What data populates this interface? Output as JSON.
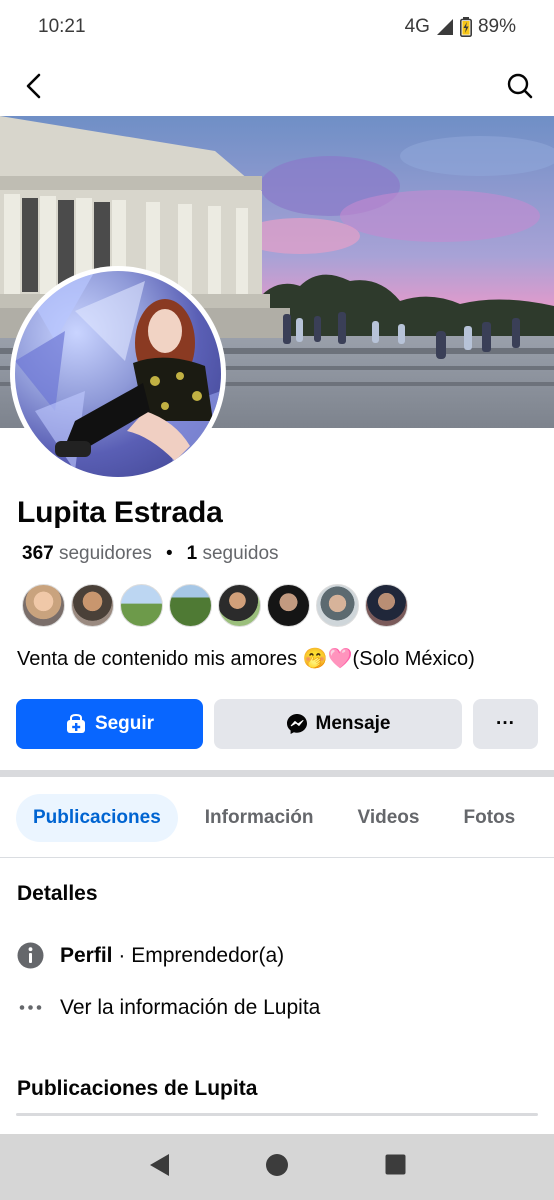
{
  "status_bar": {
    "time": "10:21",
    "network": "4G",
    "battery": "89%"
  },
  "profile": {
    "name": "Lupita Estrada",
    "followers_count": "367",
    "followers_label": "seguidores",
    "following_count": "1",
    "following_label": "seguidos",
    "bio": "Venta de contenido mis amores 🤭🩷(Solo México)"
  },
  "actions": {
    "follow_label": "Seguir",
    "message_label": "Mensaje",
    "more_label": "···"
  },
  "tabs": [
    {
      "label": "Publicaciones"
    },
    {
      "label": "Información"
    },
    {
      "label": "Videos"
    },
    {
      "label": "Fotos"
    }
  ],
  "details": {
    "title": "Detalles",
    "profile_label": "Perfil",
    "profile_sep": "·",
    "profile_value": "Emprendedor(a)",
    "see_more": "Ver la información de Lupita"
  },
  "posts_title": "Publicaciones de Lupita",
  "colors": {
    "accent": "#0866ff",
    "tab_active_bg": "#ebf5ff",
    "tab_active_text": "#0064d1"
  }
}
